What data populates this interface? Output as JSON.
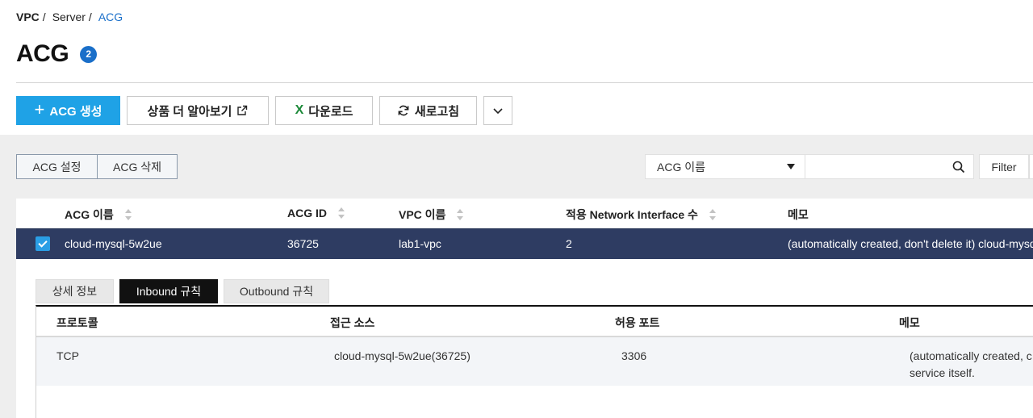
{
  "breadcrumb": [
    "VPC",
    "Server",
    "ACG"
  ],
  "page": {
    "title": "ACG",
    "count": "2"
  },
  "toolbar": {
    "create": "ACG 생성",
    "learn_more": "상품 더 알아보기",
    "download": "다운로드",
    "refresh": "새로고침"
  },
  "actions": {
    "settings": "ACG 설정",
    "delete": "ACG 삭제"
  },
  "search": {
    "field": "ACG 이름",
    "value": "",
    "filter": "Filter"
  },
  "table": {
    "columns": [
      "ACG 이름",
      "ACG ID",
      "VPC 이름",
      "적용 Network Interface 수",
      "메모"
    ],
    "rows": [
      {
        "checked": true,
        "name": "cloud-mysql-5w2ue",
        "id": "36725",
        "vpc": "lab1-vpc",
        "ni_count": "2",
        "memo": "(automatically created, don't delete it) cloud-mysql"
      }
    ]
  },
  "detail": {
    "tabs": [
      "상세 정보",
      "Inbound 규칙",
      "Outbound 규칙"
    ],
    "active_tab": "Inbound 규칙",
    "rule_columns": [
      "프로토콜",
      "접근 소스",
      "허용 포트",
      "메모"
    ],
    "rules": [
      {
        "protocol": "TCP",
        "source": "cloud-mysql-5w2ue(36725)",
        "port": "3306",
        "memo_line1": "(automatically created, c",
        "memo_line2": "service itself."
      }
    ]
  },
  "colors": {
    "primary": "#1fa2e6",
    "selected_row": "#2e3c62",
    "link": "#1a6fc9"
  },
  "icons": [
    "plus-icon",
    "external-link-icon",
    "excel-icon",
    "refresh-icon",
    "chevron-down-icon",
    "caret-down-icon",
    "search-icon",
    "sort-icon",
    "checkbox-checked-icon"
  ]
}
